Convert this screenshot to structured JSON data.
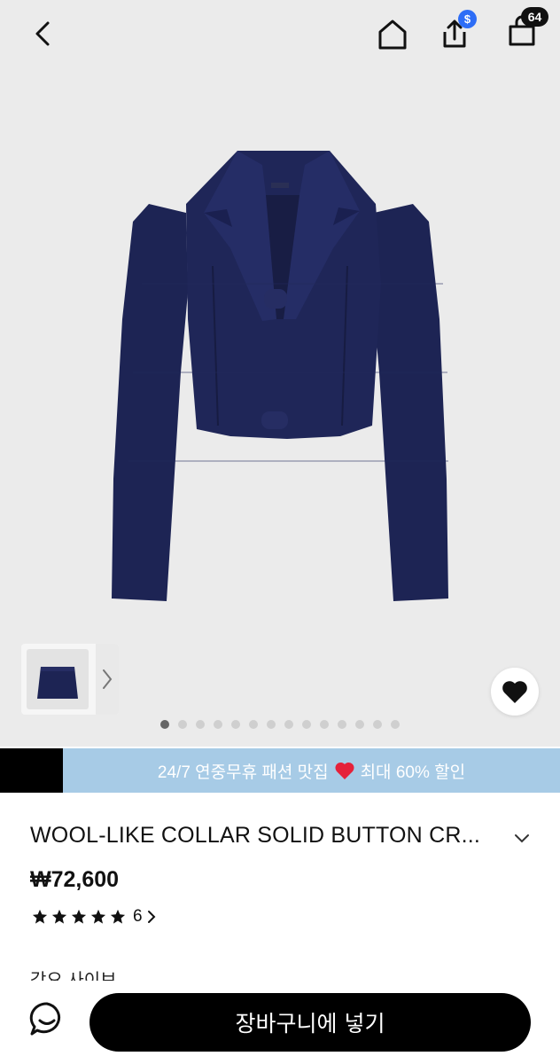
{
  "header": {
    "icons": [
      "back-arrow-icon",
      "home-icon",
      "share-icon",
      "shopping-bag-icon"
    ],
    "share_badge": "$",
    "cart_count": "64"
  },
  "gallery": {
    "image": "navy-cropped-jacket",
    "thumbnail": "navy-mini-skirt",
    "slide_count": 14,
    "active_slide": 1
  },
  "promo": {
    "text_before": "24/7 연중무휴 패션 맛집",
    "emoji": "heart",
    "text_after": "최대 60% 할인"
  },
  "product": {
    "title": "WOOL-LIKE COLLAR SOLID BUTTON CR...",
    "price": "₩72,600",
    "rating_stars": 5,
    "review_count": "6",
    "partial_text": "각요 사이브"
  },
  "bottom": {
    "add_to_cart": "장바구니에 넣기"
  },
  "colors": {
    "promo_bg": "#a7cbe6",
    "jacket": "#1c2352",
    "badge_blue": "#2d6df6"
  }
}
